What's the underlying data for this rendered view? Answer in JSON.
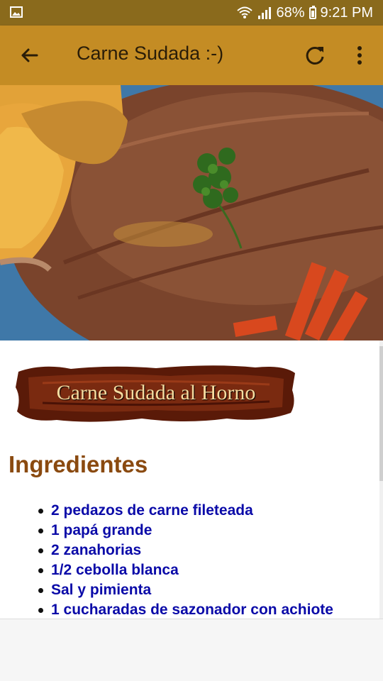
{
  "status_bar": {
    "battery": "68%",
    "time": "9:21 PM",
    "icons": [
      "image-icon",
      "wifi-icon",
      "signal-icon",
      "battery-icon"
    ]
  },
  "app_bar": {
    "title": "Carne Sudada :-)",
    "color": "#c48c24",
    "icons": [
      "back-arrow-icon",
      "refresh-icon",
      "more-vert-icon"
    ]
  },
  "recipe": {
    "banner_text": "Carne Sudada al Horno",
    "section_title": "Ingredientes",
    "ingredients": [
      "2 pedazos de carne fileteada",
      "1 papá grande",
      "2 zanahorias",
      "1/2 cebolla blanca",
      "Sal y pimienta",
      "1 cucharadas de sazonador con achiote"
    ]
  }
}
